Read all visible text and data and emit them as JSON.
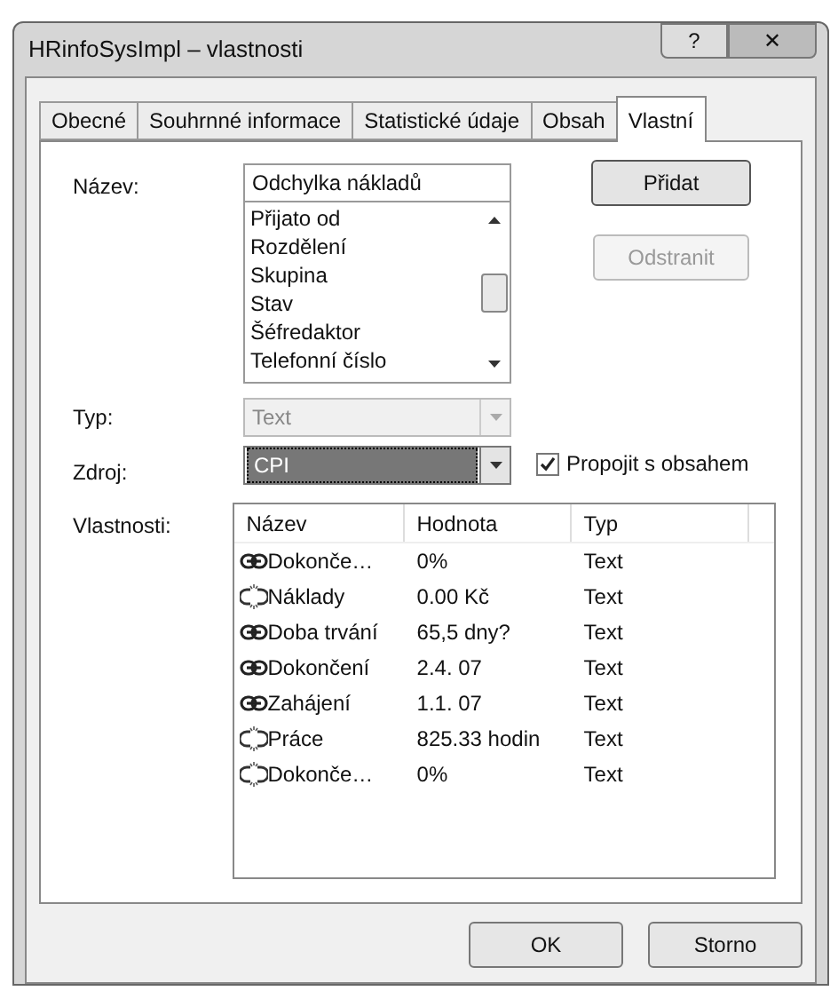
{
  "window": {
    "title": "HRinfoSysImpl – vlastnosti",
    "help": "?",
    "close": "✕"
  },
  "tabs": [
    {
      "label": "Obecné",
      "selected": false
    },
    {
      "label": "Souhrnné informace",
      "selected": false
    },
    {
      "label": "Statistické údaje",
      "selected": false
    },
    {
      "label": "Obsah",
      "selected": false
    },
    {
      "label": "Vlastní",
      "selected": true
    }
  ],
  "name": {
    "label": "Název:",
    "value": "Odchylka nákladů"
  },
  "name_list": [
    "Přijato od",
    "Rozdělení",
    "Skupina",
    "Stav",
    "Šéfredaktor",
    "Telefonní číslo"
  ],
  "add_button": {
    "label": "Přidat",
    "disabled": false
  },
  "remove_button": {
    "label": "Odstranit",
    "disabled": true
  },
  "type": {
    "label": "Typ:",
    "value": "Text",
    "disabled": true
  },
  "source": {
    "label": "Zdroj:",
    "value": "CPI"
  },
  "link_checkbox": {
    "label": "Propojit s obsahem",
    "checked": true
  },
  "properties": {
    "label": "Vlastnosti:",
    "columns": [
      "Název",
      "Hodnota",
      "Typ"
    ],
    "rows": [
      {
        "name": "Dokonče…",
        "value": "0%",
        "type": "Text",
        "linked": true
      },
      {
        "name": "Náklady",
        "value": "0.00 Kč",
        "type": "Text",
        "linked": false
      },
      {
        "name": "Doba trvání",
        "value": "65,5 dny?",
        "type": "Text",
        "linked": true
      },
      {
        "name": "Dokončení",
        "value": "2.4. 07",
        "type": "Text",
        "linked": true
      },
      {
        "name": "Zahájení",
        "value": "1.1. 07",
        "type": "Text",
        "linked": true
      },
      {
        "name": "Práce",
        "value": "825.33 hodin",
        "type": "Text",
        "linked": false
      },
      {
        "name": "Dokonče…",
        "value": "0%",
        "type": "Text",
        "linked": false
      }
    ]
  },
  "buttons": [
    "OK",
    "Storno"
  ]
}
